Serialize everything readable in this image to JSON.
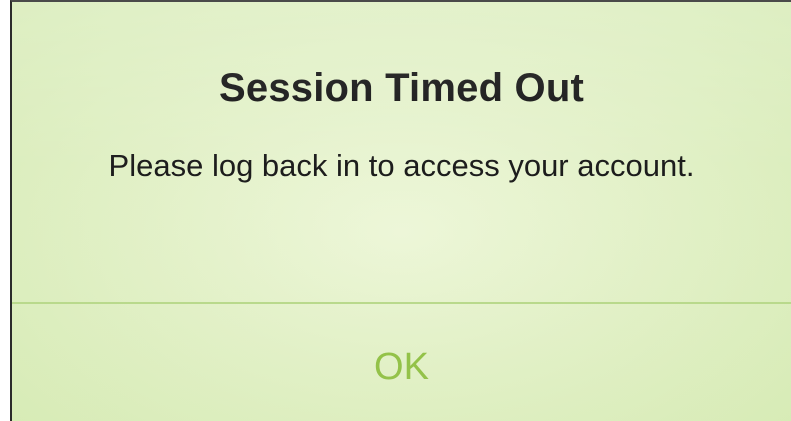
{
  "alert": {
    "title": "Session Timed Out",
    "message": "Please log back in to access your account.",
    "button_label": "OK"
  },
  "colors": {
    "accent": "#8bbd3c",
    "background": "#e3f1c9",
    "divider": "#b7d889",
    "title_text": "#111111"
  }
}
